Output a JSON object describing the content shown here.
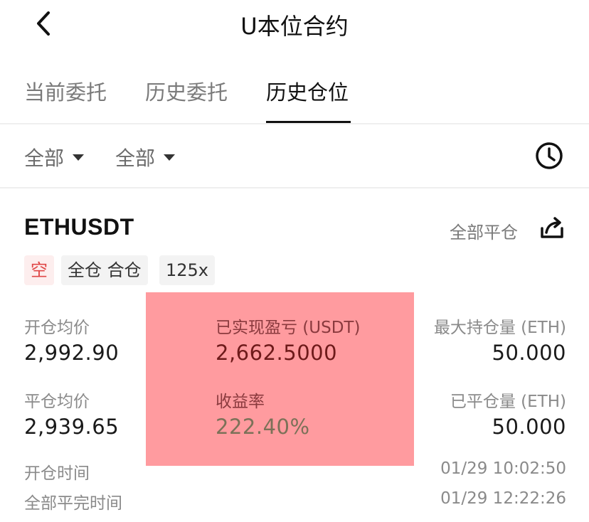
{
  "header": {
    "title": "U本位合约",
    "back_icon": "chevron-left-icon"
  },
  "tabs": [
    {
      "label": "当前委托",
      "active": false
    },
    {
      "label": "历史委托",
      "active": false
    },
    {
      "label": "历史仓位",
      "active": true
    }
  ],
  "filters": [
    {
      "label": "全部",
      "icon": "caret-down-icon"
    },
    {
      "label": "全部",
      "icon": "caret-down-icon"
    }
  ],
  "history_icon": "clock-icon",
  "position": {
    "symbol": "ETHUSDT",
    "close_all_label": "全部平仓",
    "share_icon": "share-icon",
    "tags": {
      "side": "空",
      "margin_mode": "全仓 合仓",
      "leverage": "125x"
    },
    "open_avg_price": {
      "label": "开仓均价",
      "value": "2,992.90"
    },
    "realized_pnl": {
      "label": "已实现盈亏 (USDT)",
      "value": "2,662.5000"
    },
    "max_position": {
      "label": "最大持仓量 (ETH)",
      "value": "50.000"
    },
    "close_avg_price": {
      "label": "平仓均价",
      "value": "2,939.65"
    },
    "roe": {
      "label": "收益率",
      "value": "222.40%"
    },
    "closed_position": {
      "label": "已平仓量 (ETH)",
      "value": "50.000"
    },
    "open_time": {
      "label": "开仓时间",
      "value": "01/29 10:02:50"
    },
    "full_close_time": {
      "label": "全部平完时间",
      "value": "01/29 12:22:26"
    }
  },
  "colors": {
    "short_red": "#e04848",
    "highlight": "#ff787d",
    "text_dark": "#1a1a1a",
    "text_muted": "#8a8a8a"
  }
}
